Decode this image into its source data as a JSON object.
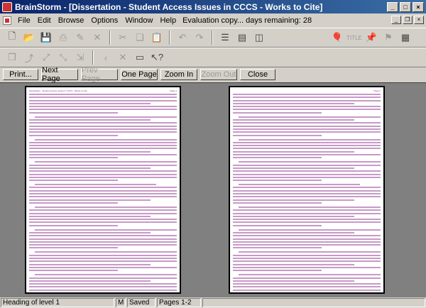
{
  "window": {
    "title": "BrainStorm - [Dissertation - Student Access Issues in CCCS - Works to Cite]"
  },
  "menu": {
    "items": [
      "File",
      "Edit",
      "Browse",
      "Options",
      "Window",
      "Help"
    ],
    "evaluation_note": "Evaluation copy... days remaining: 28"
  },
  "toolbar1_icons": [
    "new-icon",
    "open-folder-icon",
    "save-icon",
    "print-icon",
    "tools-icon",
    "delete-icon",
    "cut-icon",
    "copy-icon",
    "paste-icon",
    "undo-icon",
    "redo-icon",
    "outline-icon",
    "view-icon",
    "split-view-icon",
    "balloon-icon",
    "title-icon",
    "pin-icon",
    "bookmark-icon",
    "grid-icon"
  ],
  "toolbar2_icons": [
    "doc-copy-icon",
    "link-icon",
    "expand-icon",
    "collapse-icon",
    "arrow-icon",
    "back-icon",
    "close-window-icon",
    "window-icon",
    "help-cursor-icon"
  ],
  "preview_bar": {
    "print": "Print...",
    "next_page": "Next Page",
    "prev_page": "Prev Page",
    "one_page": "One Page",
    "zoom_in": "Zoom In",
    "zoom_out": "Zoom Out",
    "close": "Close"
  },
  "pages": {
    "left_header": "Dissertation - Student Access Issues in CCCS - Works to Cite",
    "left_page": "Page 1",
    "right_page": "Page 2"
  },
  "status": {
    "heading": "Heading of level 1",
    "mode": "M",
    "saved": "Saved",
    "pages": "Pages 1-2"
  }
}
